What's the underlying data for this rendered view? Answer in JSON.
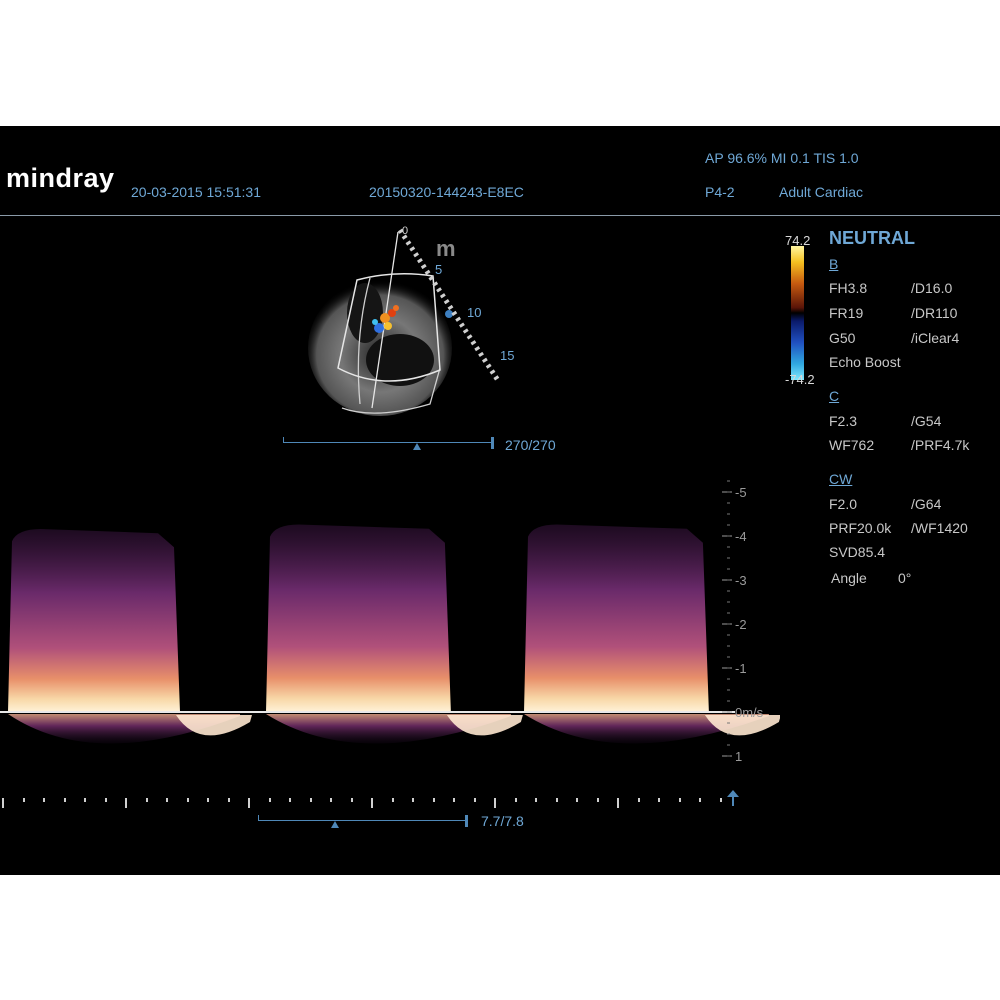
{
  "header": {
    "brand": "mindray",
    "datetime": "20-03-2015 15:51:31",
    "exam_id": "20150320-144243-E8EC",
    "power_readout": "AP 96.6%  MI 0.1 TIS 1.0",
    "probe": "P4-2",
    "preset": "Adult Cardiac"
  },
  "colorbar": {
    "max": "74.2",
    "min": "-74.2"
  },
  "params": {
    "mode_title": "NEUTRAL",
    "b_header": "B",
    "b_rows": [
      [
        "FH3.8",
        "/D16.0"
      ],
      [
        "FR19",
        "/DR110"
      ],
      [
        "G50",
        "/iClear4"
      ]
    ],
    "b_extra": "Echo Boost",
    "c_header": "C",
    "c_rows": [
      [
        "F2.3",
        "/G54"
      ],
      [
        "WF762",
        "/PRF4.7k"
      ]
    ],
    "cw_header": "CW",
    "cw_rows": [
      [
        "F2.0",
        "/G64"
      ],
      [
        "PRF20.0k",
        "/WF1420"
      ]
    ],
    "cw_svd": "SVD85.4",
    "angle_label": "Angle",
    "angle_value": "0°"
  },
  "twod": {
    "depth_marker": "m",
    "depth_ticks": [
      "0",
      "5",
      "10",
      "15"
    ],
    "frame_counter": "270/270"
  },
  "spectral": {
    "velocity_unit": "m/s",
    "scale_ticks": [
      "-5",
      "-4",
      "-3",
      "-2",
      "-1",
      "0m/s",
      "1"
    ],
    "time_counter": "7.7/7.8"
  },
  "chart_data": {
    "type": "area",
    "ylabel": "m/s",
    "ylim": [
      -5.4,
      1.2
    ],
    "cycles": [
      {
        "start_s": 0.0,
        "end_s": 0.4,
        "peak_velocity": -4.2
      },
      {
        "start_s": 0.6,
        "end_s": 1.03,
        "peak_velocity": -4.3
      },
      {
        "start_s": 1.2,
        "end_s": 1.63,
        "peak_velocity": -4.3
      }
    ]
  }
}
